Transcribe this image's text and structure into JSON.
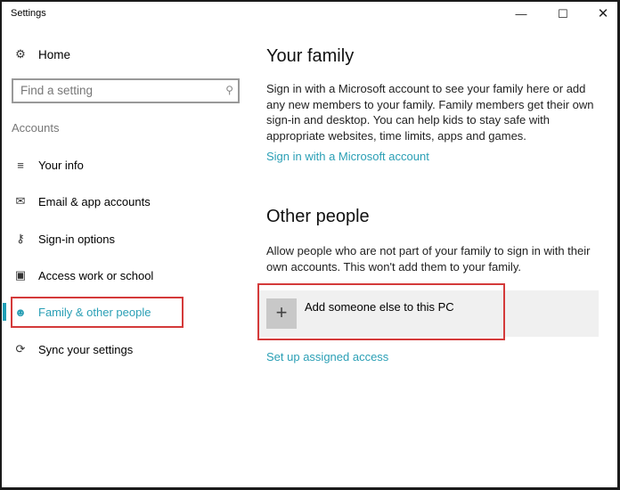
{
  "window": {
    "title": "Settings",
    "controls": [
      "minimize",
      "maximize",
      "close"
    ]
  },
  "sidebar": {
    "home": "Home",
    "search_placeholder": "Find a setting",
    "section": "Accounts",
    "items": [
      {
        "label": "Your info",
        "icon": "contact-info-icon"
      },
      {
        "label": "Email & app accounts",
        "icon": "mail-icon"
      },
      {
        "label": "Sign-in options",
        "icon": "key-icon"
      },
      {
        "label": "Access work or school",
        "icon": "briefcase-icon"
      },
      {
        "label": "Family & other people",
        "icon": "person-icon",
        "selected": true
      },
      {
        "label": "Sync your settings",
        "icon": "sync-icon"
      }
    ]
  },
  "main": {
    "family": {
      "title": "Your family",
      "description": "Sign in with a Microsoft account to see your family here or add any new members to your family. Family members get their own sign-in and desktop. You can help kids to stay safe with appropriate websites, time limits, apps and games.",
      "link": "Sign in with a Microsoft account"
    },
    "other": {
      "title": "Other people",
      "description": "Allow people who are not part of your family to sign in with their own accounts. This won't add them to your family.",
      "add_label": "Add someone else to this PC",
      "link": "Set up assigned access"
    }
  },
  "colors": {
    "accent": "#2a9fb5",
    "highlight_box": "#d43a3a"
  }
}
